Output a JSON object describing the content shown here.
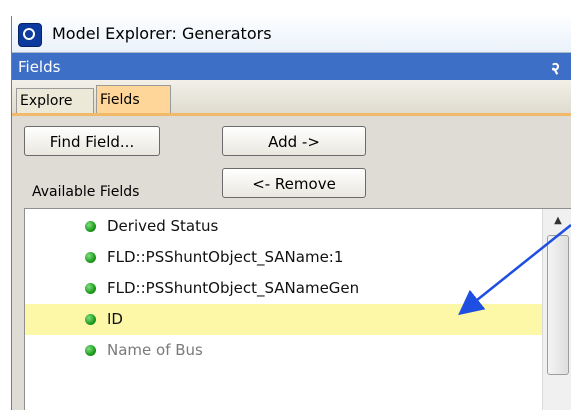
{
  "window": {
    "title": "Model Explorer: Generators"
  },
  "panel": {
    "title": "Fields",
    "pin_glyph": "२"
  },
  "tabs": [
    {
      "label": "Explore",
      "active": false
    },
    {
      "label": "Fields",
      "active": true
    }
  ],
  "buttons": {
    "find_field": "Find Field...",
    "add": "Add ->",
    "remove": "<- Remove"
  },
  "available_label": "Available Fields",
  "fields": [
    {
      "label": "Derived Status",
      "selected": false
    },
    {
      "label": "FLD::PSShuntObject_SAName:1",
      "selected": false
    },
    {
      "label": "FLD::PSShuntObject_SANameGen",
      "selected": false
    },
    {
      "label": "ID",
      "selected": true
    },
    {
      "label": "Name of Bus",
      "selected": false
    }
  ],
  "colors": {
    "accent_blue": "#3e6fc6",
    "tab_active": "#ffd69a",
    "tab_underline": "#f1b96a",
    "selection": "#fdf7a8",
    "status_green": "#1e9a1e",
    "annotation_arrow": "#1f4fe0"
  },
  "icons": {
    "app": "model-explorer-icon",
    "pin": "pin-icon",
    "bullet": "green-status-dot-icon",
    "scroll_up": "scroll-up-arrow-icon"
  }
}
